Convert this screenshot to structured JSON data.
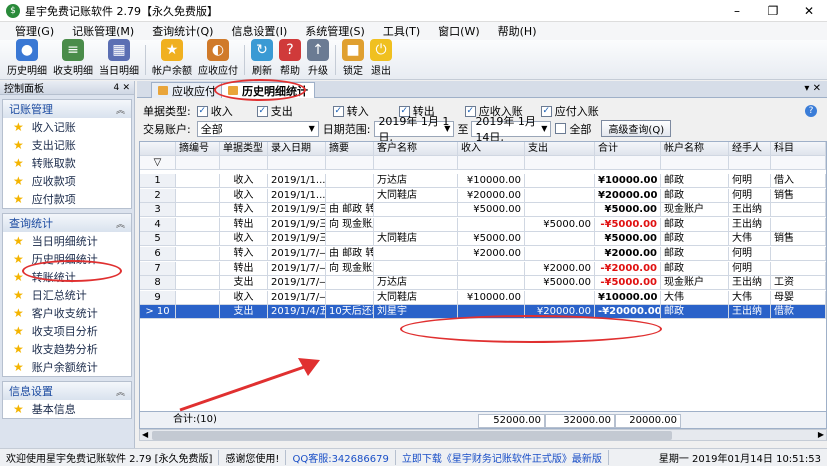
{
  "window": {
    "title": "星宇免费记账软件 2.79【永久免费版】",
    "minimize": "–",
    "restore": "❐",
    "close": "✕"
  },
  "menu": [
    "管理(G)",
    "记账管理(M)",
    "查询统计(Q)",
    "信息设置(I)",
    "系统管理(S)",
    "工具(T)",
    "窗口(W)",
    "帮助(H)"
  ],
  "toolbar": [
    {
      "label": "历史明细",
      "icon": "history-icon",
      "color": "#3a78d4"
    },
    {
      "label": "收支明细",
      "icon": "ledger-icon",
      "color": "#4a8c4a"
    },
    {
      "label": "当日明细",
      "icon": "calendar-icon",
      "color": "#5b6fb3"
    },
    {
      "label": "帐户余额",
      "icon": "star-icon",
      "color": "#f0b020"
    },
    {
      "label": "应收应付",
      "icon": "receivable-icon",
      "color": "#d07a2a"
    },
    {
      "label": "刷新",
      "icon": "refresh-icon",
      "color": "#3a9ad4"
    },
    {
      "label": "帮助",
      "icon": "help-icon",
      "color": "#d03a3a"
    },
    {
      "label": "升级",
      "icon": "upgrade-icon",
      "color": "#6b7b93"
    },
    {
      "label": "锁定",
      "icon": "lock-icon",
      "color": "#e0a030"
    },
    {
      "label": "退出",
      "icon": "exit-icon",
      "color": "#f0c020"
    }
  ],
  "left_panel": {
    "title": "控制面板",
    "pin": "4",
    "close": "✕",
    "groups": [
      {
        "title": "记账管理",
        "items": [
          "收入记账",
          "支出记账",
          "转账取款",
          "应收款项",
          "应付款项"
        ]
      },
      {
        "title": "查询统计",
        "items": [
          "当日明细统计",
          "历史明细统计",
          "转账统计",
          "日汇总统计",
          "客户收支统计",
          "收支项目分析",
          "收支趋势分析",
          "账户余额统计"
        ]
      },
      {
        "title": "信息设置",
        "items": [
          "基本信息"
        ]
      }
    ]
  },
  "tabs": [
    {
      "label": "应收应付",
      "active": false
    },
    {
      "label": "历史明细统计",
      "active": true
    }
  ],
  "filters": {
    "type_label": "单据类型:",
    "types": [
      "收入",
      "支出",
      "转入",
      "转出",
      "应收入账",
      "应付入账"
    ],
    "account_label": "交易账户:",
    "account_value": "全部",
    "date_label": "日期范围:",
    "date_from": "2019年 1月 1日,",
    "date_sep": "至",
    "date_to": "2019年 1月14日,",
    "all_label": "全部",
    "search_button": "高级查询(Q)"
  },
  "grid": {
    "columns": [
      "",
      "摘编号",
      "单据类型",
      "录入日期",
      "摘要",
      "客户名称",
      "收入",
      "支出",
      "合计",
      "帐户名称",
      "经手人",
      "科目"
    ],
    "filter_icon": "▽",
    "rows": [
      [
        "1",
        "",
        "收入",
        "2019/1/1...",
        "",
        "万达店",
        "¥10000.00",
        "",
        "¥10000.00",
        "邮政",
        "何明",
        "借入"
      ],
      [
        "2",
        "",
        "收入",
        "2019/1/1...",
        "",
        "大同鞋店",
        "¥20000.00",
        "",
        "¥20000.00",
        "邮政",
        "何明",
        "销售"
      ],
      [
        "3",
        "",
        "转入",
        "2019/1/9/三",
        "由 邮政 转入金...",
        "",
        "¥5000.00",
        "",
        "¥5000.00",
        "现金账户",
        "王出纳",
        ""
      ],
      [
        "4",
        "",
        "转出",
        "2019/1/9/三",
        "向 现金账户 转...",
        "",
        "",
        "¥5000.00",
        "-¥5000.00",
        "邮政",
        "王出纳",
        ""
      ],
      [
        "5",
        "",
        "收入",
        "2019/1/9/三",
        "",
        "大同鞋店",
        "¥5000.00",
        "",
        "¥5000.00",
        "邮政",
        "大伟",
        "销售"
      ],
      [
        "6",
        "",
        "转入",
        "2019/1/7/—",
        "由 邮政 转入金...",
        "",
        "¥2000.00",
        "",
        "¥2000.00",
        "邮政",
        "何明",
        ""
      ],
      [
        "7",
        "",
        "转出",
        "2019/1/7/—",
        "向 现金账户 转...",
        "",
        "",
        "¥2000.00",
        "-¥2000.00",
        "邮政",
        "何明",
        ""
      ],
      [
        "8",
        "",
        "支出",
        "2019/1/7/—",
        "",
        "万达店",
        "",
        "¥5000.00",
        "-¥5000.00",
        "现金账户",
        "王出纳",
        "工资"
      ],
      [
        "9",
        "",
        "收入",
        "2019/1/7/—",
        "",
        "大同鞋店",
        "¥10000.00",
        "",
        "¥10000.00",
        "大伟",
        "大伟",
        "母婴"
      ],
      [
        "> 10",
        "",
        "支出",
        "2019/1/4/五",
        "10天后还款可...",
        "刘星宇",
        "",
        "¥20000.00",
        "-¥20000.00",
        "邮政",
        "王出纳",
        "借款"
      ]
    ],
    "totals": {
      "label": "合计:(10)",
      "income": "52000.00",
      "expense": "32000.00",
      "total": "20000.00"
    }
  },
  "status": [
    "欢迎使用星宇免费记账软件 2.79 [永久免费版]",
    "感谢您使用!",
    "QQ客服:342686679",
    "立即下载《星宇财务记账软件正式版》最新版",
    "星期一 2019年01月14日 10:51:53"
  ]
}
